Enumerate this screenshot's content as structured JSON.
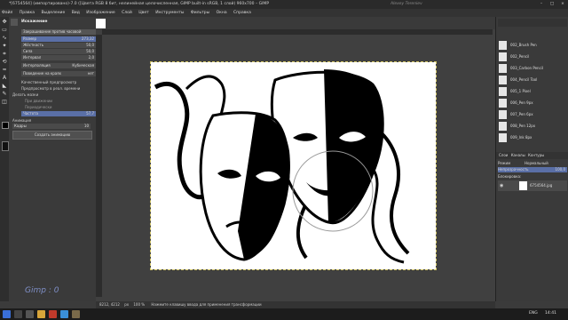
{
  "window": {
    "title": "*[6754564] (импортировано)-7.0 ([Цвета RGB 8 бит, нелинейная целочисленная, GIMP built-in sRGB, 1 слой) 960x700 – GIMP",
    "watermark": "Alexey Tereniev"
  },
  "menu": [
    "Файл",
    "Правка",
    "Выделение",
    "Вид",
    "Изображение",
    "Слой",
    "Цвет",
    "Инструменты",
    "Фильтры",
    "Окна",
    "Справка"
  ],
  "tool_options": {
    "header": "Искажение",
    "mode_label": "Закрашивание против часовой",
    "rows": [
      {
        "label": "Размер",
        "value": "273,32"
      },
      {
        "label": "Жёсткость",
        "value": "50,0"
      },
      {
        "label": "Сила",
        "value": "50,0"
      },
      {
        "label": "Интервал",
        "value": "2,0"
      }
    ],
    "interpolation_label": "Интерполяция",
    "interpolation_value": "Кубическая",
    "abyss_label": "Поведение на краях",
    "abyss_value": "нет",
    "checkbox1": "Качественный предпросмотр",
    "checkbox2": "Предпросмотр в реал. времени",
    "stroke_label": "Делать мазки",
    "radio1": "При движении",
    "radio2": "Периодически",
    "rate_label": "Частота",
    "rate_value": "57,7",
    "anim_label": "Анимация",
    "frames_label": "Кадры",
    "frames_value": "10",
    "create_button": "Создать анимацию"
  },
  "brushes": [
    "002_Brush Pen",
    "002_Pencil",
    "003_Carbon Pencil",
    "004_Pencil Tool",
    "005_1 Pixel",
    "006_Pen 9px",
    "007_Pen 6px",
    "008_Pen 12px",
    "009_Ink 8px"
  ],
  "layers_panel": {
    "tabs": [
      "Слои",
      "Каналы",
      "Контуры"
    ],
    "mode_label": "Режим",
    "mode_value": "Нормальный",
    "opacity_label": "Непрозрачность",
    "opacity_value": "100,0",
    "lock_label": "Блокировка:",
    "layer_name": "6754564.jpg"
  },
  "status": {
    "coords": "8212, 4212",
    "unit": "px",
    "zoom": "100 %",
    "message": "Нажмите клавишу ввода для применения трансформации"
  },
  "taskbar": {
    "time": "14:41",
    "lang": "ENG"
  },
  "gimp_watermark": "Gimp : 0",
  "colors": {
    "canvas_bg": "#404040",
    "panel_bg": "#3a3a3a",
    "titlebar": "#2a2a2a",
    "accent": "#d6c96a"
  }
}
